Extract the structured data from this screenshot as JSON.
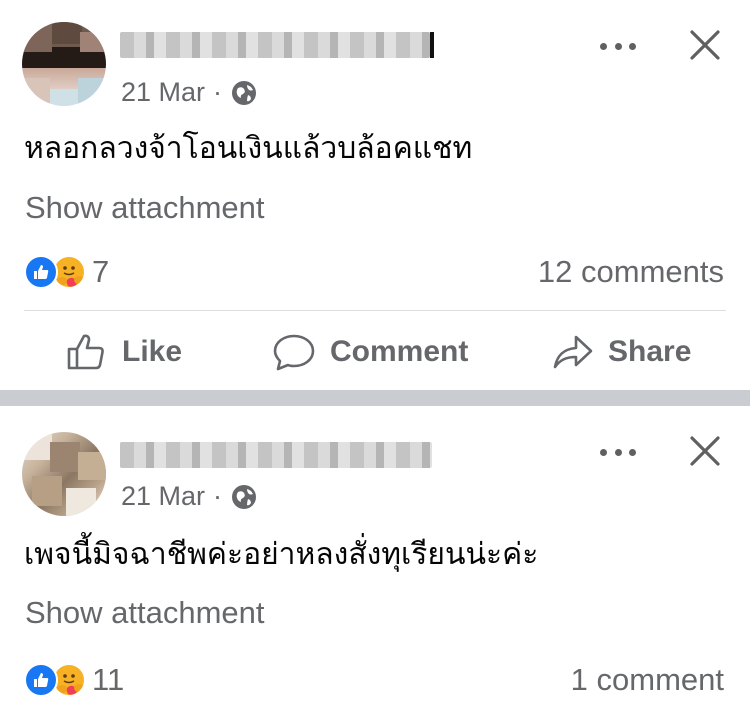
{
  "posts": [
    {
      "date": "21 Mar",
      "separator": "·",
      "text": "หลอกลวงจ้าโอนเงินแล้วบล้อคแชท",
      "attachment_label": "Show attachment",
      "reaction_count": "7",
      "comments_label": "12 comments",
      "icons": {
        "avatar": "avatar",
        "privacy": "globe-icon",
        "more": "more-icon",
        "close": "close-icon",
        "reactions": [
          "like-reaction-icon",
          "care-reaction-icon"
        ]
      }
    },
    {
      "date": "21 Mar",
      "separator": "·",
      "text": "เพจนี้มิจฉาชีพค่ะอย่าหลงสั่งทุเรียนน่ะค่ะ",
      "attachment_label": "Show attachment",
      "reaction_count": "11",
      "comments_label": "1 comment",
      "icons": {
        "avatar": "avatar",
        "privacy": "globe-icon",
        "more": "more-icon",
        "close": "close-icon",
        "reactions": [
          "like-reaction-icon",
          "care-reaction-icon"
        ]
      }
    }
  ],
  "actions": {
    "like_label": "Like",
    "comment_label": "Comment",
    "share_label": "Share"
  },
  "colors": {
    "secondary_text": "#65676b",
    "like_blue": "#1877f2",
    "care_yellow": "#f7b125",
    "separator_gray": "#c9ccd1"
  }
}
